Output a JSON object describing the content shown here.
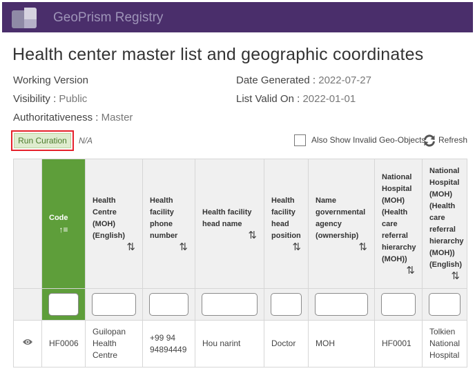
{
  "app": {
    "title": "GeoPrism Registry"
  },
  "page": {
    "title": "Health center master list and geographic coordinates"
  },
  "meta": {
    "working_version": "Working Version",
    "visibility_label": "Visibility : ",
    "visibility_value": "Public",
    "authoritativeness_label": "Authoritativeness : ",
    "authoritativeness_value": "Master",
    "date_generated_label": "Date Generated : ",
    "date_generated_value": "2022-07-27",
    "list_valid_label": "List Valid On : ",
    "list_valid_value": "2022-01-01"
  },
  "toolbar": {
    "run_curation": "Run Curation",
    "curation_status": "N/A",
    "invalid_label": "Also Show Invalid Geo-Objects",
    "refresh": "Refresh"
  },
  "table": {
    "headers": [
      "Code",
      "Health Centre (MOH) (English)",
      "Health facility phone number",
      "Health facility head name",
      "Health facility head position",
      "Name governmental agency (ownership)",
      "National Hospital (MOH) (Health care referral hierarchy (MOH))",
      "National Hospital (MOH) (Health care referral hierarchy (MOH)) (English)"
    ],
    "sort_glyph": "⇅",
    "code_sort_glyph": "↑≡",
    "rows": [
      [
        "HF0006",
        "Guilopan Health Centre",
        "+99 94 94894449",
        "Hou narint",
        "Doctor",
        "MOH",
        "HF0001",
        "Tolkien National Hospital"
      ]
    ]
  },
  "colors": {
    "topbar": "#4a2e6b",
    "code_column": "#5e9e3a",
    "curation_border": "#e5202a",
    "curation_fill": "#dfeccf"
  },
  "icons": {
    "row_view": "eye-icon",
    "refresh": "refresh-icon",
    "logo": "logo-icon"
  }
}
